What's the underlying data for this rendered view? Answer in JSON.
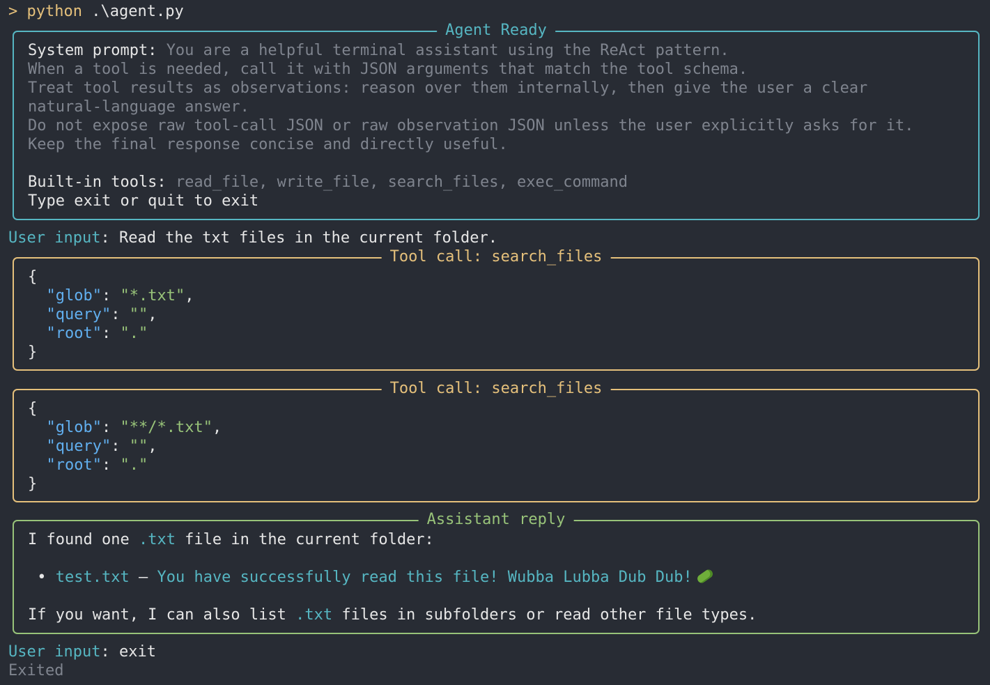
{
  "prompt": {
    "symbol": ">",
    "command": "python",
    "args": ".\\agent.py"
  },
  "agent_ready": {
    "title": "Agent Ready",
    "system_label": "System prompt:",
    "system_lines": [
      "You are a helpful terminal assistant using the ReAct pattern.",
      "When a tool is needed, call it with JSON arguments that match the tool schema.",
      "Treat tool results as observations: reason over them internally, then give the user a clear",
      "natural-language answer.",
      "Do not expose raw tool-call JSON or raw observation JSON unless the user explicitly asks for it.",
      "Keep the final response concise and directly useful."
    ],
    "tools_label": "Built-in tools:",
    "tools_list": "read_file, write_file, search_files, exec_command",
    "exit_hint": "Type exit or quit to exit"
  },
  "user_input_1": {
    "label": "User input",
    "separator": ":",
    "text": "Read the txt files in the current folder."
  },
  "tool_call_1": {
    "title": "Tool call: search_files",
    "open": "{",
    "close": "}",
    "args": [
      {
        "key": "\"glob\"",
        "value": "\"*.txt\"",
        "comma": ","
      },
      {
        "key": "\"query\"",
        "value": "\"\"",
        "comma": ","
      },
      {
        "key": "\"root\"",
        "value": "\".\"",
        "comma": ""
      }
    ]
  },
  "tool_call_2": {
    "title": "Tool call: search_files",
    "open": "{",
    "close": "}",
    "args": [
      {
        "key": "\"glob\"",
        "value": "\"**/*.txt\"",
        "comma": ","
      },
      {
        "key": "\"query\"",
        "value": "\"\"",
        "comma": ","
      },
      {
        "key": "\"root\"",
        "value": "\".\"",
        "comma": ""
      }
    ]
  },
  "assistant_reply": {
    "title": "Assistant reply",
    "line1_pre": "I found one ",
    "line1_code": ".txt",
    "line1_post": " file in the current folder:",
    "bullet": "•",
    "file_name": "test.txt",
    "dash": "—",
    "file_content": "You have successfully read this file! Wubba Lubba Dub Dub!",
    "emoji": "pickle-icon",
    "line3_pre": "If you want, I can also list ",
    "line3_code": ".txt",
    "line3_post": " files in subfolders or read other file types."
  },
  "user_input_2": {
    "label": "User input",
    "separator": ":",
    "text": "exit"
  },
  "status": "Exited",
  "colors": {
    "background": "#282c34",
    "cyan": "#56b6c2",
    "yellow": "#e5c07b",
    "green": "#98c379",
    "blue": "#61afef",
    "dim": "#7f848e"
  }
}
